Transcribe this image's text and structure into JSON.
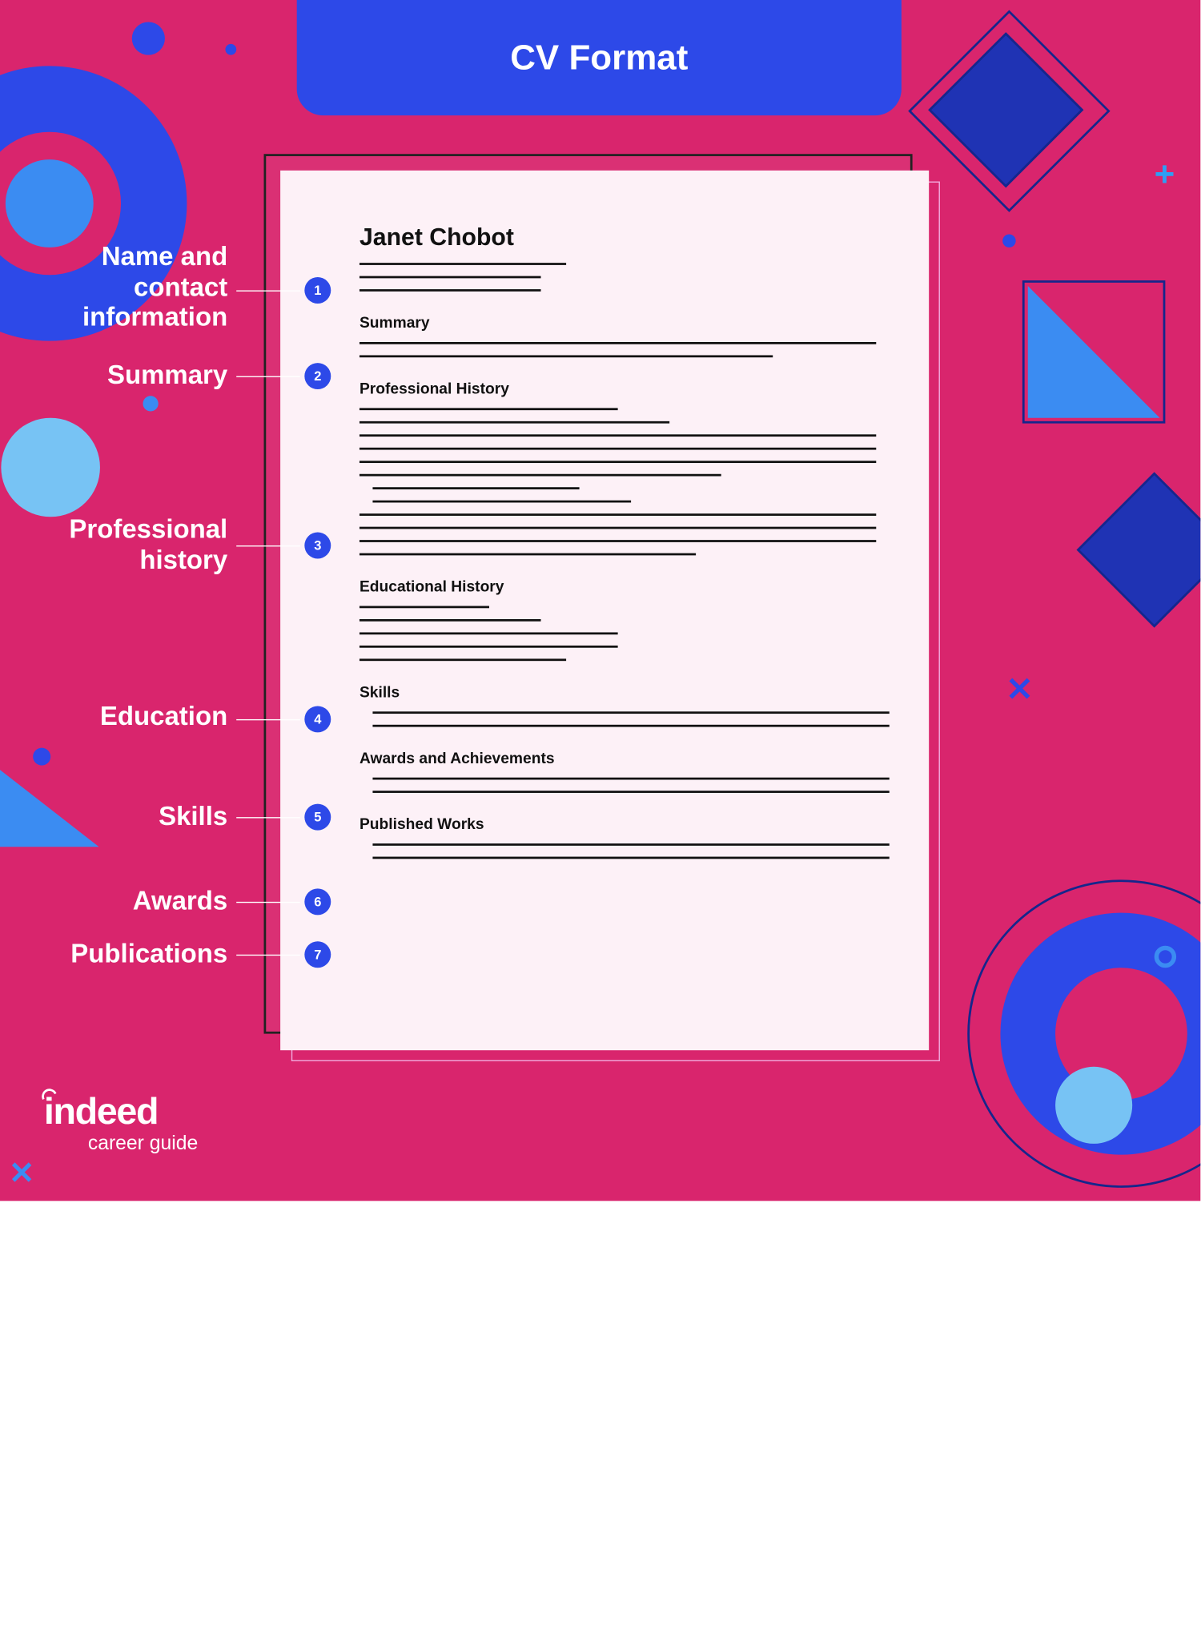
{
  "title": "CV Format",
  "cv": {
    "name": "Janet Chobot",
    "sections": {
      "summary": "Summary",
      "professional_history": "Professional History",
      "educational_history": "Educational History",
      "skills": "Skills",
      "awards": "Awards and Achievements",
      "published": "Published Works"
    }
  },
  "callouts": [
    {
      "num": "1",
      "label": "Name and\ncontact\ninformation"
    },
    {
      "num": "2",
      "label": "Summary"
    },
    {
      "num": "3",
      "label": "Professional\nhistory"
    },
    {
      "num": "4",
      "label": "Education"
    },
    {
      "num": "5",
      "label": "Skills"
    },
    {
      "num": "6",
      "label": "Awards"
    },
    {
      "num": "7",
      "label": "Publications"
    }
  ],
  "logo": {
    "brand": "indeed",
    "sub": "career guide"
  }
}
